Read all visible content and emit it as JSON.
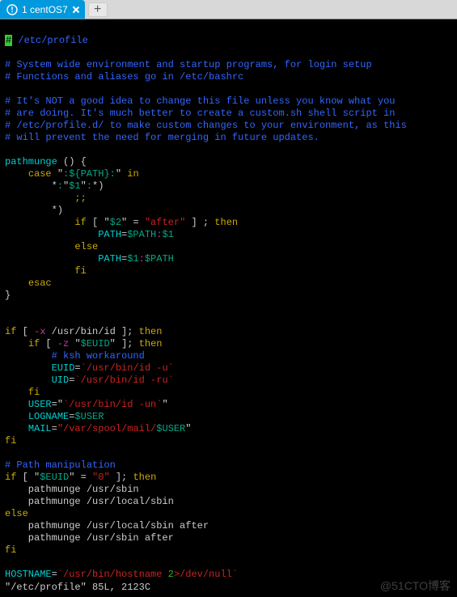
{
  "tabs": {
    "active": {
      "label": "1 centOS7"
    }
  },
  "file": {
    "path_display": "/etc/profile",
    "status_line": "\"/etc/profile\" 85L, 2123C"
  },
  "comments": {
    "c1": "# System wide environment and startup programs, for login setup",
    "c2": "# Functions and aliases go in /etc/bashrc",
    "c3": "# It's NOT a good idea to change this file unless you know what you",
    "c4": "# are doing. It's much better to create a custom.sh shell script in",
    "c5": "# /etc/profile.d/ to make custom changes to your environment, as this",
    "c6": "# will prevent the need for merging in future updates.",
    "ksh": "# ksh workaround",
    "pathman": "# Path manipulation"
  },
  "code": {
    "fn_name": "pathmunge",
    "fn_paren": " () {",
    "case_kw": "case",
    "case_arg_q1": " \"",
    "case_arg_c1": ":",
    "case_arg_var": "${PATH}",
    "case_arg_c2": ":",
    "case_arg_q2": "\" ",
    "in_kw": "in",
    "pat1_a": "*",
    "pat1_b": ":",
    "pat1_c": "\"",
    "pat1_var": "$1",
    "pat1_d": "\"",
    "pat1_e": ":",
    "pat1_f": "*)",
    "dsemi": ";;",
    "pat2": "*)",
    "if_kw": "if",
    "test_open": " [ ",
    "q": "\"",
    "arg2": "$2",
    "eq": " = ",
    "after": "\"after\"",
    "test_close": " ] ; ",
    "then_kw": "then",
    "path_lhs": "PATH",
    "assign": "=",
    "pathvar": "$PATH",
    "colon": ":",
    "arg1": "$1",
    "else_kw": "else",
    "fi_kw": "fi",
    "esac_kw": "esac",
    "brace_close": "}",
    "x_flag": "-x",
    "usr_bin_id": " /usr/bin/id ",
    "rbr": "]; ",
    "z_flag": "-z",
    "sp": " ",
    "euid": "$EUID",
    "euid_lhs": "EUID",
    "uid_lhs": "UID",
    "bt": "`",
    "id_u": "/usr/bin/id -u",
    "id_ru": "/usr/bin/id -ru",
    "id_un": "/usr/bin/id -un",
    "user_lhs": "USER",
    "logname_lhs": "LOGNAME",
    "user_var": "$USER",
    "mail_lhs": "MAIL",
    "mail_path": "\"/var/spool/mail/",
    "zero": "\"0\"",
    "pm_usr_sbin": "    pathmunge /usr/sbin",
    "pm_usr_local_sbin": "    pathmunge /usr/local/sbin",
    "pm_usr_local_sbin_after": "    pathmunge /usr/local/sbin after",
    "pm_usr_sbin_after": "    pathmunge /usr/sbin after",
    "hostname_lhs": "HOSTNAME",
    "hostname_cmd": "/usr/bin/hostname ",
    "two": "2",
    "devnull": ">/dev/null"
  },
  "watermark": "@51CTO博客"
}
